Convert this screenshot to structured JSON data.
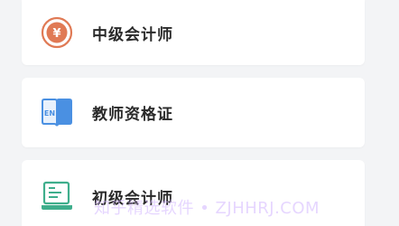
{
  "items": [
    {
      "label": "中级会计师",
      "icon": "yen-coin-icon",
      "color": "#e07a55"
    },
    {
      "label": "教师资格证",
      "icon": "en-book-icon",
      "color": "#4a90e2"
    },
    {
      "label": "初级会计师",
      "icon": "laptop-icon",
      "color": "#3fae8c"
    }
  ],
  "icon_text": {
    "yen": "¥",
    "en": "EN"
  },
  "watermark": "知乎精选软件 • ZJHHRJ.COM"
}
